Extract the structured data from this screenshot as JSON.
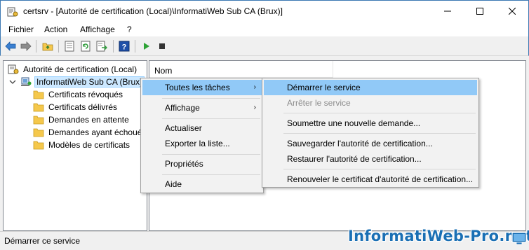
{
  "window": {
    "title": "certsrv - [Autorité de certification (Local)\\InformatiWeb Sub CA (Brux)]"
  },
  "menubar": {
    "items": [
      "Fichier",
      "Action",
      "Affichage",
      "?"
    ]
  },
  "toolbar": {
    "icons": [
      "back-arrow-icon",
      "forward-arrow-icon",
      "up-folder-icon",
      "properties-icon",
      "refresh-icon",
      "export-list-icon",
      "help-icon",
      "start-service-icon",
      "stop-service-icon"
    ]
  },
  "tree": {
    "root": "Autorité de certification (Local)",
    "ca_node": "InformatiWeb Sub CA (Brux)",
    "children": [
      "Certificats révoqués",
      "Certificats délivrés",
      "Demandes en attente",
      "Demandes ayant échoué",
      "Modèles de certificats"
    ]
  },
  "list": {
    "column_name": "Nom"
  },
  "context_menu": {
    "all_tasks": "Toutes les tâches",
    "view": "Affichage",
    "refresh": "Actualiser",
    "export_list": "Exporter la liste...",
    "properties": "Propriétés",
    "help": "Aide"
  },
  "submenu": {
    "start_service": "Démarrer le service",
    "stop_service": "Arrêter le service",
    "submit_request": "Soumettre une nouvelle demande...",
    "backup_ca": "Sauvegarder l'autorité de certification...",
    "restore_ca": "Restaurer l'autorité de certification...",
    "renew_ca_cert": "Renouveler le certificat d'autorité de certification..."
  },
  "statusbar": {
    "text": "Démarrer ce service"
  },
  "watermark": {
    "text": "InformatiWeb-Pro.net"
  },
  "colors": {
    "highlight": "#91c9f7",
    "selection": "#cce8ff",
    "watermark": "#1a6fb4",
    "folder": "#f5c84c",
    "toolbar_arrow": "#3a7fd0"
  }
}
